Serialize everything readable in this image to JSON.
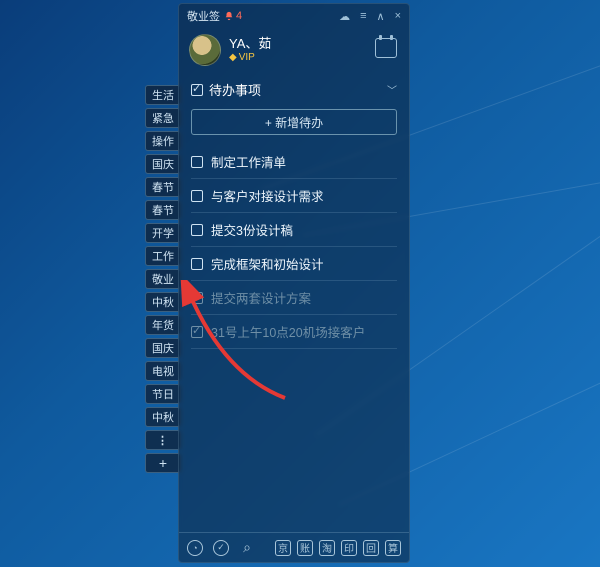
{
  "app": {
    "title": "敬业签",
    "notification_count": 4
  },
  "titlebar_icons": {
    "cloud": "☁",
    "menu": "≡",
    "collapse": "∧",
    "close": "×"
  },
  "profile": {
    "name": "YA、茹",
    "vip_label": "VIP",
    "diamond": "◆"
  },
  "section": {
    "title": "待办事项",
    "chevron": "﹀"
  },
  "add_button": {
    "label": "+ 新增待办"
  },
  "todos": [
    {
      "label": "制定工作清单",
      "done": false
    },
    {
      "label": "与客户对接设计需求",
      "done": false
    },
    {
      "label": "提交3份设计稿",
      "done": false
    },
    {
      "label": "完成框架和初始设计",
      "done": false
    },
    {
      "label": "提交两套设计方案",
      "done": true
    },
    {
      "label": "31号上午10点20机场接客户",
      "done": true
    }
  ],
  "sidebar_chips": [
    "生活",
    "紧急",
    "操作",
    "国庆",
    "春节",
    "春节",
    "开学",
    "工作",
    "敬业",
    "中秋",
    "年货",
    "国庆",
    "电视",
    "节日",
    "中秋"
  ],
  "bottombar": {
    "left": [
      {
        "name": "clock-icon",
        "glyph": "◔"
      },
      {
        "name": "check-icon",
        "glyph": "✓"
      },
      {
        "name": "search-icon",
        "glyph": "⌕"
      }
    ],
    "right": [
      {
        "name": "jing-icon",
        "glyph": "京"
      },
      {
        "name": "zhang-icon",
        "glyph": "账"
      },
      {
        "name": "tao-icon",
        "glyph": "淘"
      },
      {
        "name": "yin-icon",
        "glyph": "印"
      },
      {
        "name": "hui-icon",
        "glyph": "回"
      },
      {
        "name": "suan-icon",
        "glyph": "算"
      }
    ]
  }
}
